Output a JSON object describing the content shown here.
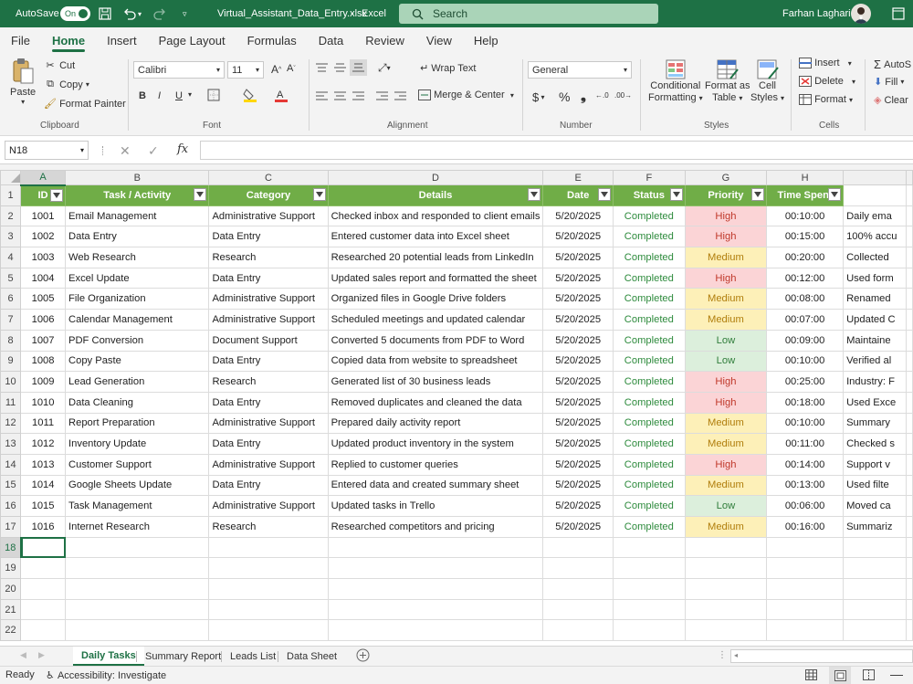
{
  "titlebar": {
    "autosave_label": "AutoSave",
    "autosave_state": "On",
    "file_title": "Virtual_Assistant_Data_Entry.xlsx",
    "app_name": "Excel",
    "search_placeholder": "Search",
    "user_name": "Farhan Laghari"
  },
  "menu": [
    "File",
    "Home",
    "Insert",
    "Page Layout",
    "Formulas",
    "Data",
    "Review",
    "View",
    "Help"
  ],
  "menu_active": "Home",
  "ribbon": {
    "clipboard": {
      "paste": "Paste",
      "cut": "Cut",
      "copy": "Copy",
      "format_painter": "Format Painter",
      "group": "Clipboard"
    },
    "font": {
      "name": "Calibri",
      "size": "11",
      "group": "Font"
    },
    "alignment": {
      "wrap": "Wrap Text",
      "merge": "Merge & Center",
      "group": "Alignment"
    },
    "number": {
      "format": "General",
      "group": "Number"
    },
    "styles": {
      "conditional_1": "Conditional",
      "conditional_2": "Formatting",
      "format_table_1": "Format as",
      "format_table_2": "Table",
      "cell_styles_1": "Cell",
      "cell_styles_2": "Styles",
      "group": "Styles"
    },
    "cells": {
      "insert": "Insert",
      "delete": "Delete",
      "format": "Format",
      "group": "Cells"
    },
    "editing": {
      "autosum": "AutoS",
      "fill": "Fill",
      "clear": "Clear"
    }
  },
  "formula_bar": {
    "name_box": "N18",
    "fx": "fx",
    "content": ""
  },
  "columns": [
    "A",
    "B",
    "C",
    "D",
    "E",
    "F",
    "G",
    "H",
    ""
  ],
  "header": [
    "ID",
    "Task / Activity",
    "Category",
    "Details",
    "Date",
    "Status",
    "Priority",
    "Time Spent",
    ""
  ],
  "rows": [
    {
      "id": "1001",
      "task": "Email Management",
      "category": "Administrative Support",
      "details": "Checked inbox and responded to client emails",
      "date": "5/20/2025",
      "status": "Completed",
      "priority": "High",
      "time": "00:10:00",
      "notes": "Daily ema"
    },
    {
      "id": "1002",
      "task": "Data Entry",
      "category": "Data Entry",
      "details": "Entered customer data into Excel sheet",
      "date": "5/20/2025",
      "status": "Completed",
      "priority": "High",
      "time": "00:15:00",
      "notes": "100% accu"
    },
    {
      "id": "1003",
      "task": "Web Research",
      "category": "Research",
      "details": "Researched 20 potential leads from LinkedIn",
      "date": "5/20/2025",
      "status": "Completed",
      "priority": "Medium",
      "time": "00:20:00",
      "notes": "Collected"
    },
    {
      "id": "1004",
      "task": "Excel Update",
      "category": "Data Entry",
      "details": "Updated sales report and formatted the sheet",
      "date": "5/20/2025",
      "status": "Completed",
      "priority": "High",
      "time": "00:12:00",
      "notes": "Used form"
    },
    {
      "id": "1005",
      "task": "File Organization",
      "category": "Administrative Support",
      "details": "Organized files in Google Drive folders",
      "date": "5/20/2025",
      "status": "Completed",
      "priority": "Medium",
      "time": "00:08:00",
      "notes": "Renamed"
    },
    {
      "id": "1006",
      "task": "Calendar Management",
      "category": "Administrative Support",
      "details": "Scheduled meetings and updated calendar",
      "date": "5/20/2025",
      "status": "Completed",
      "priority": "Medium",
      "time": "00:07:00",
      "notes": "Updated C"
    },
    {
      "id": "1007",
      "task": "PDF Conversion",
      "category": "Document Support",
      "details": "Converted 5 documents from PDF to Word",
      "date": "5/20/2025",
      "status": "Completed",
      "priority": "Low",
      "time": "00:09:00",
      "notes": "Maintaine"
    },
    {
      "id": "1008",
      "task": "Copy Paste",
      "category": "Data Entry",
      "details": "Copied data from website to spreadsheet",
      "date": "5/20/2025",
      "status": "Completed",
      "priority": "Low",
      "time": "00:10:00",
      "notes": "Verified al"
    },
    {
      "id": "1009",
      "task": "Lead Generation",
      "category": "Research",
      "details": "Generated list of 30 business leads",
      "date": "5/20/2025",
      "status": "Completed",
      "priority": "High",
      "time": "00:25:00",
      "notes": "Industry: F"
    },
    {
      "id": "1010",
      "task": "Data Cleaning",
      "category": "Data Entry",
      "details": "Removed duplicates and cleaned the data",
      "date": "5/20/2025",
      "status": "Completed",
      "priority": "High",
      "time": "00:18:00",
      "notes": "Used Exce"
    },
    {
      "id": "1011",
      "task": "Report Preparation",
      "category": "Administrative Support",
      "details": "Prepared daily activity report",
      "date": "5/20/2025",
      "status": "Completed",
      "priority": "Medium",
      "time": "00:10:00",
      "notes": "Summary"
    },
    {
      "id": "1012",
      "task": "Inventory Update",
      "category": "Data Entry",
      "details": "Updated product inventory in the system",
      "date": "5/20/2025",
      "status": "Completed",
      "priority": "Medium",
      "time": "00:11:00",
      "notes": "Checked s"
    },
    {
      "id": "1013",
      "task": "Customer Support",
      "category": "Administrative Support",
      "details": "Replied to customer queries",
      "date": "5/20/2025",
      "status": "Completed",
      "priority": "High",
      "time": "00:14:00",
      "notes": "Support v"
    },
    {
      "id": "1014",
      "task": "Google Sheets Update",
      "category": "Data Entry",
      "details": "Entered data and created summary sheet",
      "date": "5/20/2025",
      "status": "Completed",
      "priority": "Medium",
      "time": "00:13:00",
      "notes": "Used filte"
    },
    {
      "id": "1015",
      "task": "Task Management",
      "category": "Administrative Support",
      "details": "Updated tasks in Trello",
      "date": "5/20/2025",
      "status": "Completed",
      "priority": "Low",
      "time": "00:06:00",
      "notes": "Moved ca"
    },
    {
      "id": "1016",
      "task": "Internet Research",
      "category": "Research",
      "details": "Researched competitors and pricing",
      "date": "5/20/2025",
      "status": "Completed",
      "priority": "Medium",
      "time": "00:16:00",
      "notes": "Summariz"
    }
  ],
  "row_numbers": [
    "1",
    "2",
    "3",
    "4",
    "5",
    "6",
    "7",
    "8",
    "9",
    "10",
    "11",
    "12",
    "13",
    "14",
    "15",
    "16",
    "17",
    "18",
    "19",
    "20",
    "21",
    "22"
  ],
  "sheet_tabs": [
    "Daily Tasks",
    "Summary Report",
    "Leads List",
    "Data Sheet"
  ],
  "active_sheet": "Daily Tasks",
  "status": {
    "ready": "Ready",
    "accessibility": "Accessibility: Investigate"
  },
  "colors": {
    "brand": "#1e7145",
    "header_fill": "#70ad47",
    "high": "#fbd4d6",
    "medium": "#fdf0b8",
    "low": "#dcefdc",
    "completed": "#2e8b3d"
  }
}
